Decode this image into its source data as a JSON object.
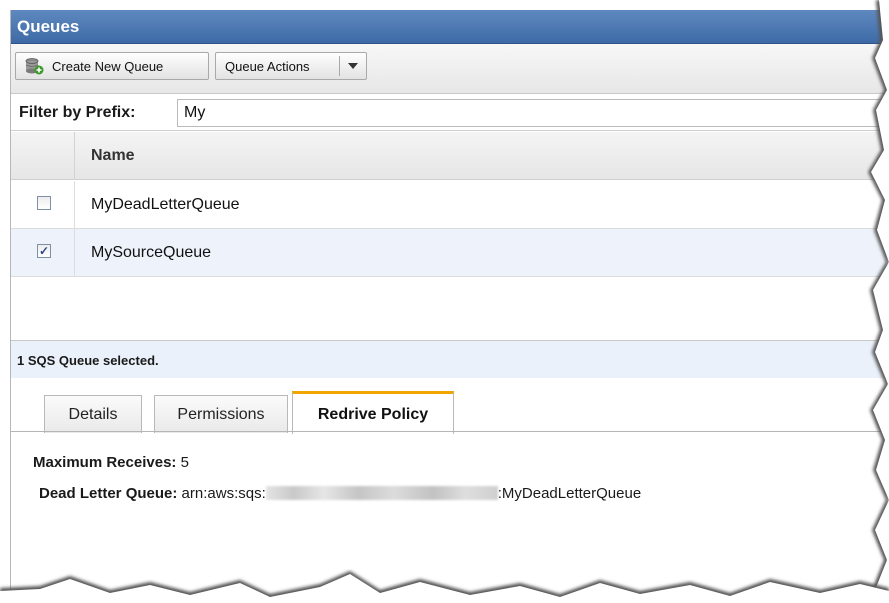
{
  "window": {
    "title": "Queues"
  },
  "toolbar": {
    "create_label": "Create New Queue",
    "create_icon": "database-add-icon",
    "actions_label": "Queue Actions",
    "actions_icon": "chevron-down-icon"
  },
  "filter": {
    "label": "Filter by Prefix:",
    "value": "My"
  },
  "table": {
    "columns": [
      "Name"
    ],
    "rows": [
      {
        "name": "MyDeadLetterQueue",
        "checked": false
      },
      {
        "name": "MySourceQueue",
        "checked": true
      }
    ]
  },
  "selection": {
    "status": "1 SQS Queue selected."
  },
  "tabs": [
    {
      "label": "Details",
      "active": false
    },
    {
      "label": "Permissions",
      "active": false
    },
    {
      "label": "Redrive Policy",
      "active": true
    }
  ],
  "redrive": {
    "max_receives_label": "Maximum Receives:",
    "max_receives_value": "5",
    "dlq_label": "Dead Letter Queue:",
    "dlq_prefix": "arn:aws:sqs:",
    "dlq_suffix": ":MyDeadLetterQueue"
  },
  "colors": {
    "titlebar": "#4a76ae",
    "selected_row": "#eef3fb",
    "active_tab_accent": "#f0a500"
  }
}
